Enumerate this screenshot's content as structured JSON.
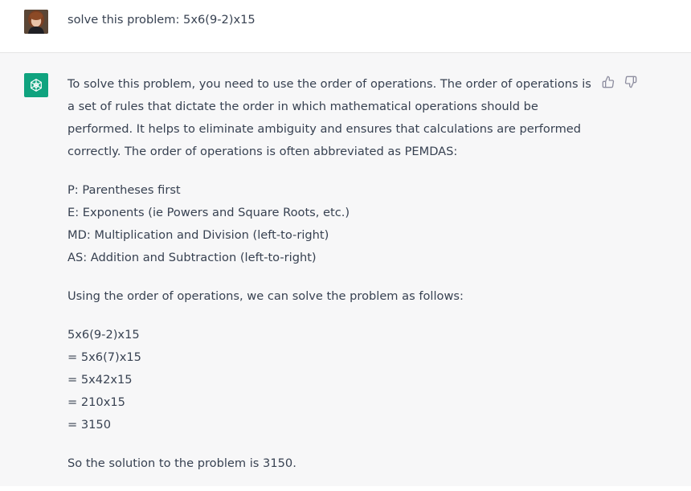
{
  "user_message": {
    "text": "solve this problem: 5x6(9-2)x15",
    "avatar_icon": "user-avatar-photo"
  },
  "assistant_message": {
    "logo_icon": "openai-logo-icon",
    "logo_color": "#10a37f",
    "intro": "To solve this problem, you need to use the order of operations. The order of operations is a set of rules that dictate the order in which mathematical operations should be performed. It helps to eliminate ambiguity and ensures that calculations are performed correctly. The order of operations is often abbreviated as PEMDAS:",
    "pemdas": [
      "P: Parentheses first",
      "E: Exponents (ie Powers and Square Roots, etc.)",
      "MD: Multiplication and Division (left-to-right)",
      "AS: Addition and Subtraction (left-to-right)"
    ],
    "transition": "Using the order of operations, we can solve the problem as follows:",
    "steps": [
      "5x6(9-2)x15",
      "= 5x6(7)x15",
      "= 5x42x15",
      "= 210x15",
      "= 3150"
    ],
    "conclusion": "So the solution to the problem is 3150."
  },
  "feedback": {
    "thumbs_up_icon": "thumbs-up-icon",
    "thumbs_down_icon": "thumbs-down-icon"
  }
}
